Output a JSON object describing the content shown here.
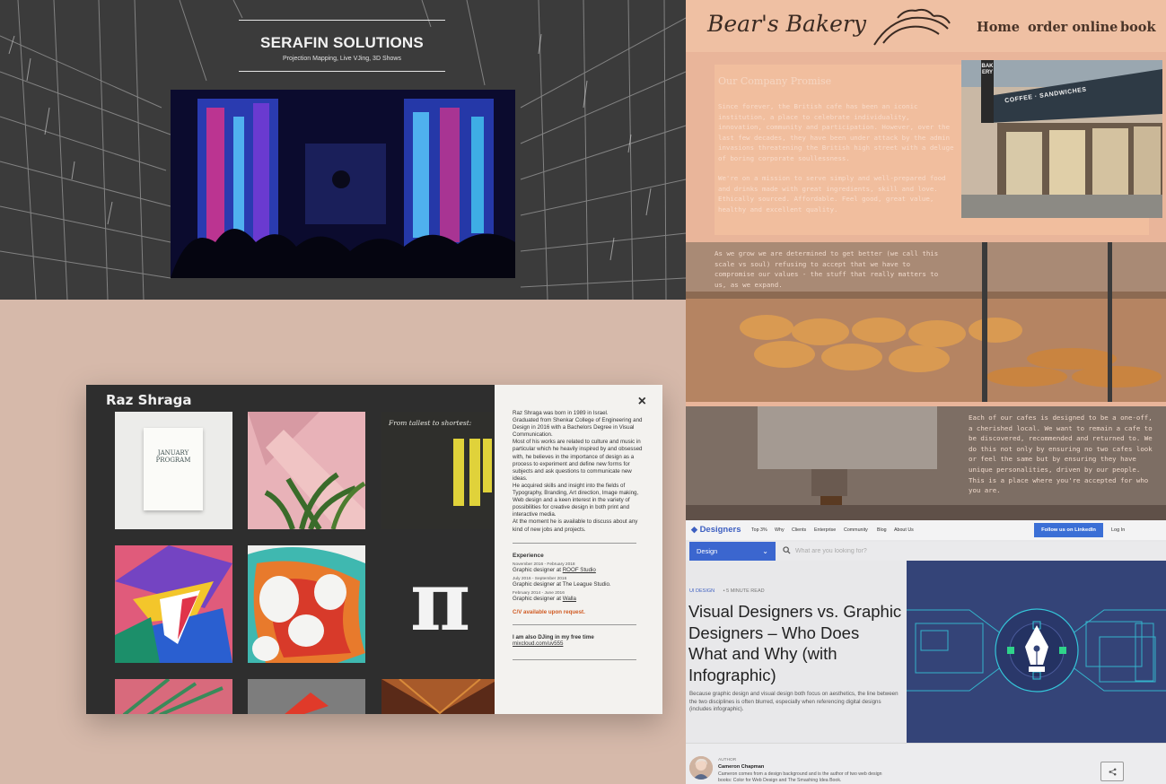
{
  "serafin": {
    "title": "SERAFIN SOLUTIONS",
    "subtitle": "Projection Mapping, Live VJing, 3D Shows"
  },
  "raz": {
    "name": "Raz Shraga",
    "close_icon": "×",
    "tiles": {
      "january_line1": "JANUARY",
      "january_line2": "PROGRAM",
      "tallest": "From tallest to shortest:",
      "pi": "π"
    },
    "bio": [
      "Raz Shraga was born in 1989 in Israel.",
      "Graduated from Shenkar College of Engineering and Design in 2016 with a Bachelors Degree in Visual Communication.",
      "Most of his works are related to culture and music in particular which he heavily inspired by and obsessed with, he believes in the importance of design as a process to experiment and define new forms for subjects and ask questions to communicate new ideas.",
      "He acquired skills and insight into the fields of Typography, Branding, Art direction, Image making, Web design and a keen interest in the variety of possibilities for creative design in both print and interactive media.",
      "At the moment he is available to discuss about any kind of new jobs and projects."
    ],
    "experience_heading": "Experience",
    "jobs": [
      {
        "dates": "November 2016 - February 2018",
        "role": "Graphic designer at ",
        "company": "ROOF Studio"
      },
      {
        "dates": "July 2016 - September 2016",
        "role": "Graphic designer at The League Studio.",
        "company": ""
      },
      {
        "dates": "February 2014 - June 2016",
        "role": "Graphic designer at ",
        "company": "Walla"
      }
    ],
    "cv_text": "C/V available upon request.",
    "dj_text": "I am also DJing in my free time",
    "mixcloud": "mixcloud.com/uv555"
  },
  "bakery": {
    "logo": "Bear's Bakery",
    "nav": [
      "Home",
      "order online",
      "book"
    ],
    "promise_title": "Our Company Promise",
    "promise_p1": "Since forever, the British cafe has been an iconic institution, a place to celebrate individuality, innovation, community and participation. However, over the last few decades, they have been under attack by the admin invasions threatening the British high street with a deluge of boring corporate soullessness.",
    "promise_p2": "We're on a mission to serve simply and well-prepared food and drinks made with great ingredients, skill and love. Ethically sourced. Affordable. Feel good, great value, healthy and excellent quality.",
    "grow_text": "As we grow we are determined to get better (we call this scale vs soul) refusing to accept that we have to compromise our values - the stuff that really matters to us, as we expand.",
    "cafes_text": "Each of our cafes is designed to be a one-off, a cherished local. We want to remain a cafe to be discovered, recommended and returned to. We do this not only by ensuring no two cafes look or feel the same but by ensuring they have unique personalities, driven by our people. This is a place where you're accepted for who you are.",
    "store_sign": "BAKERY",
    "store_awning": "COFFEE · SANDWICHES"
  },
  "designers": {
    "brand": "Designers",
    "nav": [
      "Top 3%",
      "Why",
      "Clients",
      "Enterprise",
      "Community",
      "Blog",
      "About Us"
    ],
    "follow_button": "Follow us on LinkedIn",
    "login": "Log In",
    "select_value": "Design",
    "search_placeholder": "What are you looking for?",
    "category": "UI DESIGN",
    "read_time": "• 5 MINUTE READ",
    "title": "Visual Designers vs. Graphic Designers – Who Does What and Why (with Infographic)",
    "excerpt": "Because graphic design and visual design both focus on aesthetics, the line between the two disciplines is often blurred, especially when referencing digital designs (includes infographic).",
    "author_label": "AUTHOR",
    "author_name": "Cameron Chapman",
    "author_bio": "Cameron comes from a design background and is the author of two web design books: Color for Web Design and The Smashing Idea Book."
  }
}
